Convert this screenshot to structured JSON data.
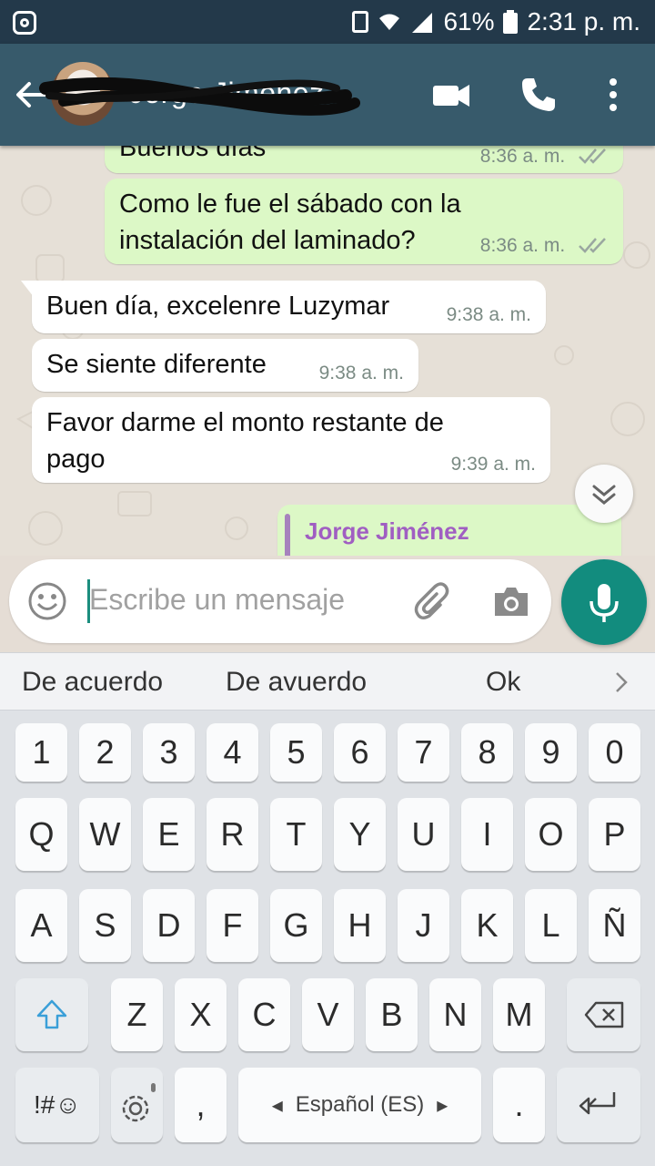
{
  "status": {
    "battery": "61%",
    "time": "2:31 p. m."
  },
  "appbar": {
    "contact_name": "Jorge Jiménez"
  },
  "messages": [
    {
      "text": "Buenos días",
      "time": "8:36 a. m."
    },
    {
      "text_line1": "Como le fue el sábado con la",
      "text_line2": "instalación del laminado?",
      "time": "8:36 a. m."
    },
    {
      "text": "Buen día, excelenre Luzymar",
      "time": "9:38 a. m."
    },
    {
      "text": "Se siente diferente",
      "time": "9:38 a. m."
    },
    {
      "text_line1": "Favor darme el monto restante de",
      "text_line2": "pago",
      "time": "9:39 a. m."
    },
    {
      "reply_name": "Jorge Jiménez"
    }
  ],
  "input": {
    "placeholder": "Escribe un mensaje"
  },
  "suggestions": [
    "De acuerdo",
    "De avuerdo",
    "Ok"
  ],
  "keyboard": {
    "row_numbers": [
      "1",
      "2",
      "3",
      "4",
      "5",
      "6",
      "7",
      "8",
      "9",
      "0"
    ],
    "row_top": [
      "Q",
      "W",
      "E",
      "R",
      "T",
      "Y",
      "U",
      "I",
      "O",
      "P"
    ],
    "row_mid": [
      "A",
      "S",
      "D",
      "F",
      "G",
      "H",
      "J",
      "K",
      "L",
      "Ñ"
    ],
    "row_bot": [
      "Z",
      "X",
      "C",
      "V",
      "B",
      "N",
      "M"
    ],
    "symbols": "!#☺",
    "comma": ",",
    "space_label": "Español (ES)",
    "period": "."
  },
  "colors": {
    "appbar": "#375a6b",
    "statusbar": "#23394a",
    "outgoing": "#dcf8c6",
    "incoming": "#ffffff",
    "accent": "#128c7e"
  }
}
